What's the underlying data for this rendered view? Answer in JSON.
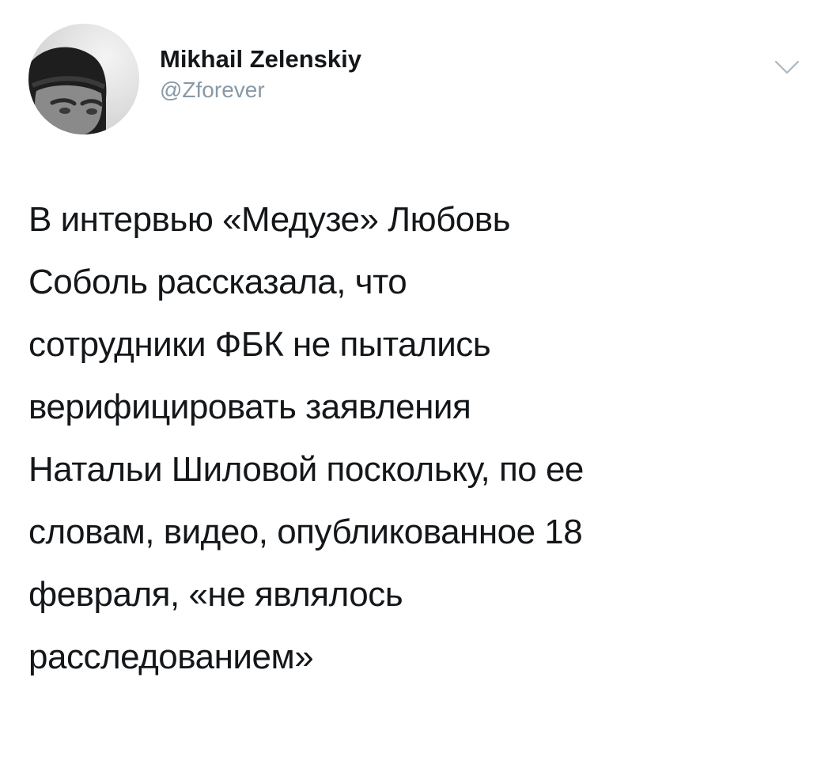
{
  "tweet": {
    "author": {
      "display_name": "Mikhail Zelenskiy",
      "handle": "@Zforever"
    },
    "text_lines": [
      "В интервью «Медузе» Любовь",
      "Соболь рассказала, что",
      "сотрудники ФБК не пытались",
      "верифицировать заявления",
      "Натальи Шиловой поскольку, по ее",
      "словам, видео, опубликованное 18",
      "февраля, «не являлось",
      "расследованием»"
    ],
    "icons": {
      "avatar": "avatar-photo",
      "menu": "chevron-down-icon"
    },
    "colors": {
      "text": "#14171a",
      "secondary": "#8899a6",
      "background": "#ffffff"
    }
  }
}
